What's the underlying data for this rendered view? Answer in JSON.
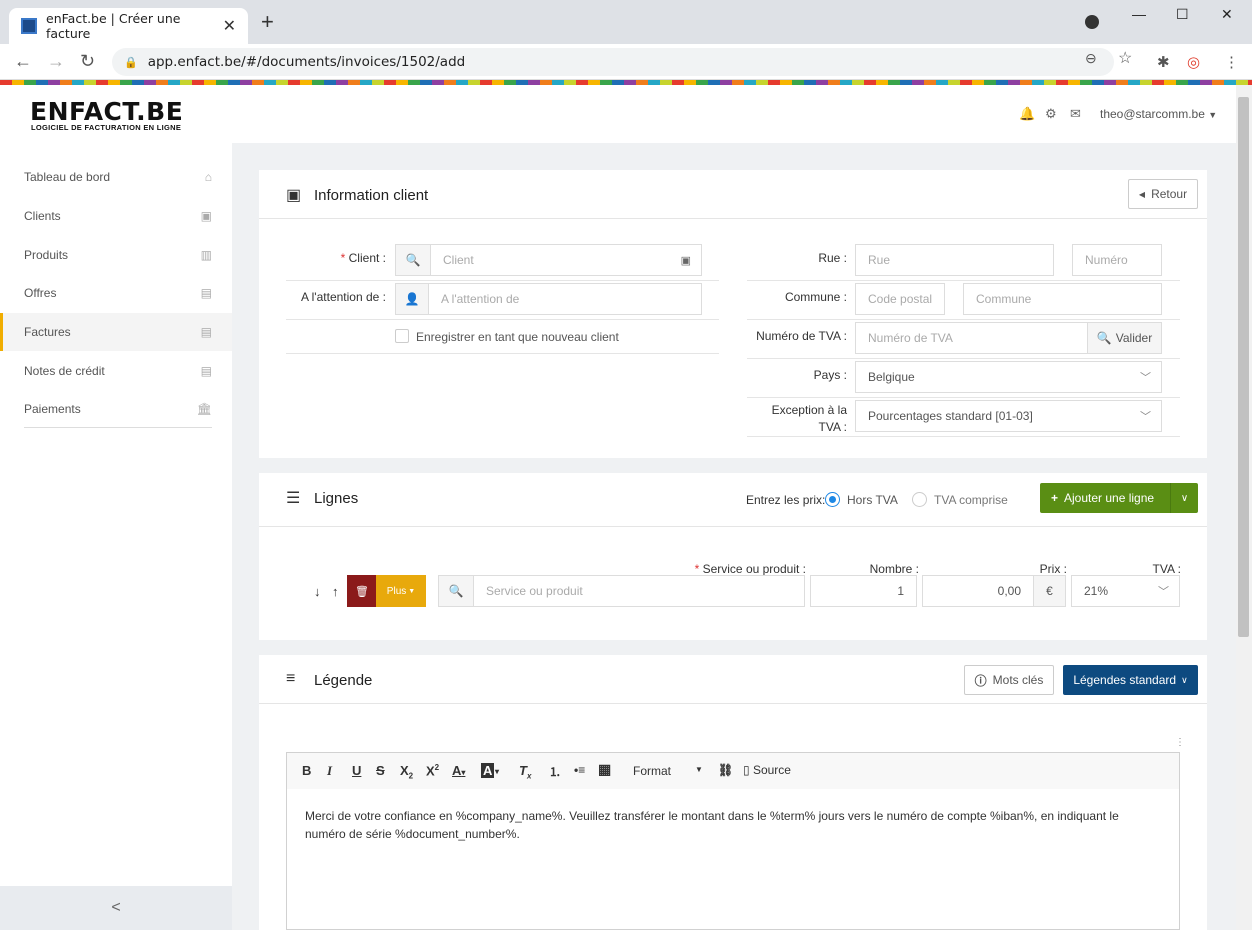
{
  "browser": {
    "tab_title": "enFact.be | Créer une facture",
    "url": "app.enfact.be/#/documents/invoices/1502/add"
  },
  "header": {
    "logo_main": "ENFACT.BE",
    "logo_sub": "LOGICIEL DE FACTURATION EN LIGNE",
    "user_email": "theo@starcomm.be"
  },
  "sidebar": {
    "items": [
      {
        "label": "Tableau de bord",
        "icon": "home-icon"
      },
      {
        "label": "Clients",
        "icon": "contact-card-icon"
      },
      {
        "label": "Produits",
        "icon": "barcode-icon"
      },
      {
        "label": "Offres",
        "icon": "pdf-file-icon"
      },
      {
        "label": "Factures",
        "icon": "pdf-file-icon"
      },
      {
        "label": "Notes de crédit",
        "icon": "pdf-file-icon"
      },
      {
        "label": "Paiements",
        "icon": "bank-icon"
      }
    ],
    "collapse": "<"
  },
  "client_panel": {
    "title": "Information client",
    "back_button": "Retour",
    "client_label": "Client",
    "client_placeholder": "Client",
    "attention_label": "A l'attention de",
    "attention_placeholder": "A l'attention de",
    "new_client_checkbox": "Enregistrer en tant que nouveau client",
    "street_label": "Rue",
    "street_placeholder": "Rue",
    "number_placeholder": "Numéro",
    "commune_label": "Commune",
    "postal_placeholder": "Code postal",
    "commune_placeholder": "Commune",
    "vat_label": "Numéro de TVA",
    "vat_placeholder": "Numéro de TVA",
    "validate_button": "Valider",
    "country_label": "Pays",
    "country_value": "Belgique",
    "vat_exception_label_1": "Exception à la",
    "vat_exception_label_2": "TVA",
    "vat_exception_value": "Pourcentages standard [01-03]"
  },
  "lines_panel": {
    "title": "Lignes",
    "price_label": "Entrez les prix:",
    "radio_excl": "Hors TVA",
    "radio_incl": "TVA comprise",
    "add_line_button": "Ajouter une ligne",
    "service_label": "Service ou produit",
    "quantity_label": "Nombre",
    "price_col_label": "Prix",
    "vat_col_label": "TVA",
    "more_button": "Plus",
    "service_placeholder": "Service ou produit",
    "quantity_value": "1",
    "price_value": "0,00",
    "currency": "€",
    "vat_value": "21%"
  },
  "legend_panel": {
    "title": "Légende",
    "keywords_button": "Mots clés",
    "standard_button": "Légendes standard",
    "format_label": "Format",
    "source_label": "Source",
    "body_text": "Merci de votre confiance en %company_name%. Veuillez transférer le montant dans le %term% jours vers le numéro de compte %iban%, en indiquant le numéro de série %document_number%."
  }
}
